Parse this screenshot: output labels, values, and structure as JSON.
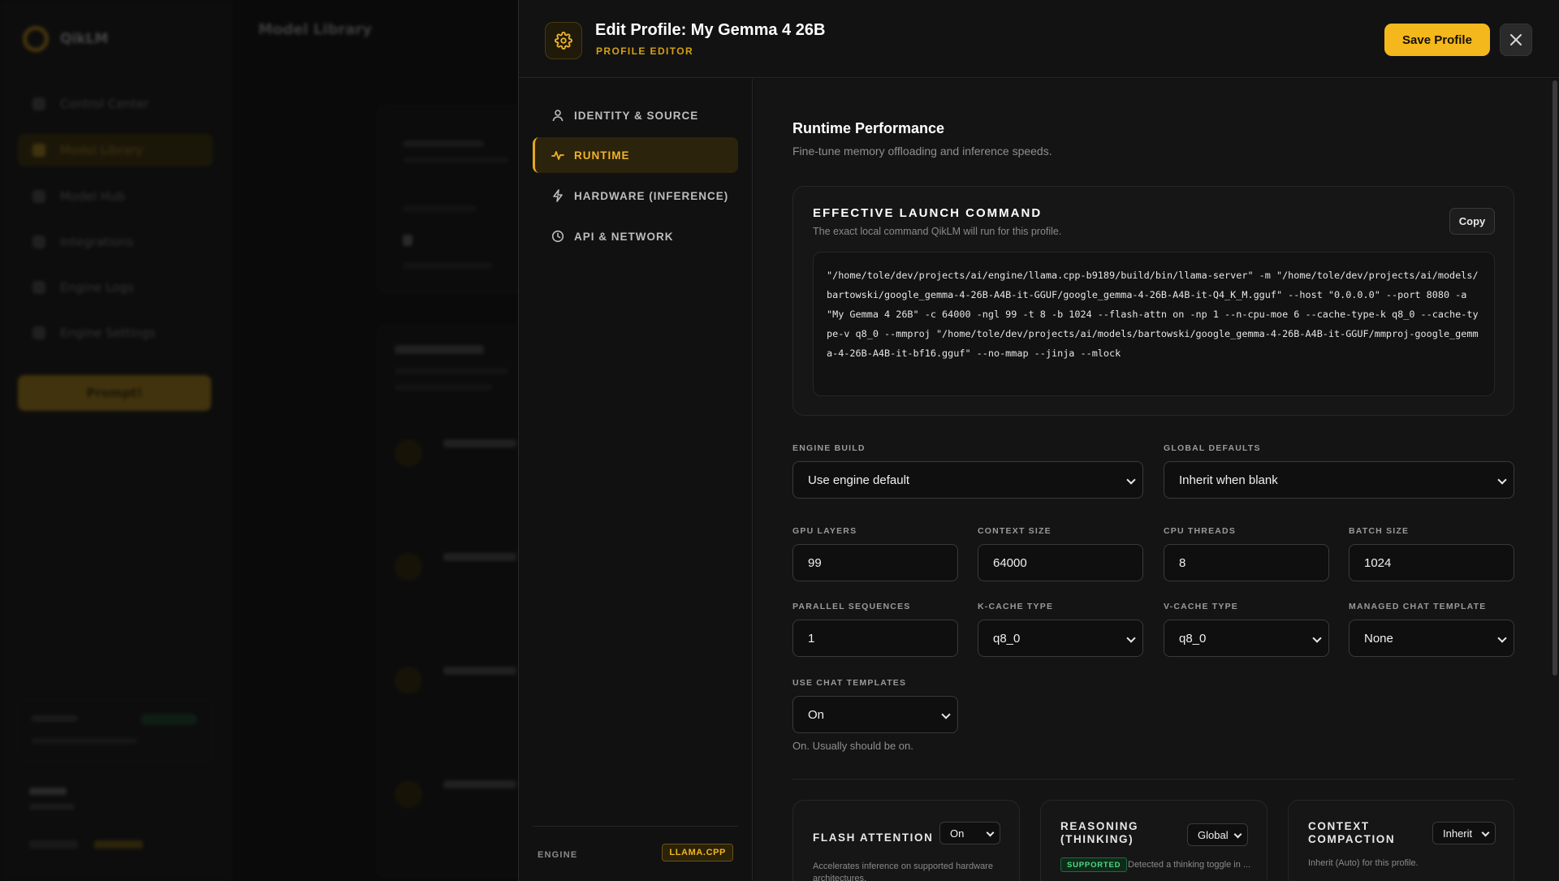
{
  "background": {
    "app_name": "QikLM",
    "nav": [
      "Control Center",
      "Model Library",
      "Model Hub",
      "Integrations",
      "Engine Logs",
      "Engine Settings"
    ],
    "cta": "Prompt!",
    "page_title": "Model Library"
  },
  "header": {
    "title": "Edit Profile: My Gemma 4 26B",
    "subtitle": "PROFILE EDITOR",
    "save_label": "Save Profile"
  },
  "nav": {
    "items": [
      {
        "label": "IDENTITY & SOURCE",
        "icon": "user-icon"
      },
      {
        "label": "RUNTIME",
        "icon": "activity-icon"
      },
      {
        "label": "HARDWARE (INFERENCE)",
        "icon": "lightning-icon"
      },
      {
        "label": "API & NETWORK",
        "icon": "clock-icon"
      }
    ],
    "active": "RUNTIME",
    "engine_label": "ENGINE",
    "engine_value": "LLAMA.CPP"
  },
  "section": {
    "title": "Runtime Performance",
    "subtitle": "Fine-tune memory offloading and inference speeds."
  },
  "command": {
    "title": "EFFECTIVE LAUNCH COMMAND",
    "description": "The exact local command QikLM will run for this profile.",
    "copy_label": "Copy",
    "text": "\"/home/tole/dev/projects/ai/engine/llama.cpp-b9189/build/bin/llama-server\" -m \"/home/tole/dev/projects/ai/models/bartowski/google_gemma-4-26B-A4B-it-GGUF/google_gemma-4-26B-A4B-it-Q4_K_M.gguf\" --host \"0.0.0.0\" --port 8080 -a \"My Gemma 4 26B\" -c 64000 -ngl 99 -t 8 -b 1024 --flash-attn on -np 1 --n-cpu-moe 6 --cache-type-k q8_0 --cache-type-v q8_0 --mmproj \"/home/tole/dev/projects/ai/models/bartowski/google_gemma-4-26B-A4B-it-GGUF/mmproj-google_gemma-4-26B-A4B-it-bf16.gguf\" --no-mmap --jinja --mlock"
  },
  "fields": {
    "engine_build": {
      "label": "ENGINE BUILD",
      "value": "Use engine default"
    },
    "global_defaults": {
      "label": "GLOBAL DEFAULTS",
      "value": "Inherit when blank"
    },
    "gpu_layers": {
      "label": "GPU LAYERS",
      "value": "99"
    },
    "context_size": {
      "label": "CONTEXT SIZE",
      "value": "64000"
    },
    "cpu_threads": {
      "label": "CPU THREADS",
      "value": "8"
    },
    "batch_size": {
      "label": "BATCH SIZE",
      "value": "1024"
    },
    "parallel_sequences": {
      "label": "PARALLEL SEQUENCES",
      "value": "1"
    },
    "k_cache_type": {
      "label": "K-CACHE TYPE",
      "value": "q8_0"
    },
    "v_cache_type": {
      "label": "V-CACHE TYPE",
      "value": "q8_0"
    },
    "managed_chat_template": {
      "label": "MANAGED CHAT TEMPLATE",
      "value": "None"
    },
    "use_chat_templates": {
      "label": "USE CHAT TEMPLATES",
      "value": "On",
      "hint": "On. Usually should be on."
    }
  },
  "cards": {
    "flash_attention": {
      "title": "FLASH ATTENTION",
      "value": "On",
      "description": "Accelerates inference on supported hardware architectures."
    },
    "reasoning": {
      "title_line1": "REASONING",
      "title_line2": "(THINKING)",
      "value": "Global",
      "badge": "SUPPORTED",
      "description": "Detected a thinking toggle in ..."
    },
    "context_compaction": {
      "title_line1": "CONTEXT",
      "title_line2": "COMPACTION",
      "value": "Inherit",
      "description": "Inherit (Auto) for this profile."
    }
  },
  "colors": {
    "accent": "#f5b81c",
    "supported": "#4ade80",
    "background": "#111111"
  }
}
